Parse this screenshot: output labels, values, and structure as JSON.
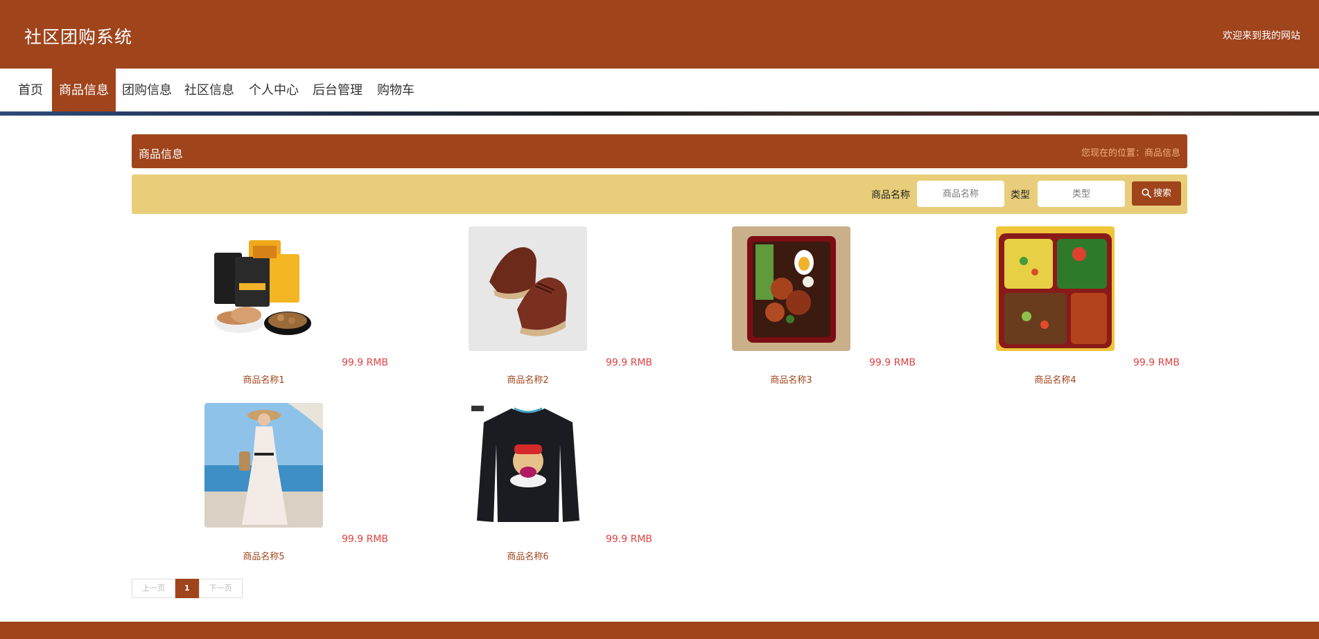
{
  "header": {
    "site_title": "社区团购系统",
    "welcome": "欢迎来到我的网站"
  },
  "nav": {
    "items": [
      {
        "label": "首页"
      },
      {
        "label": "商品信息"
      },
      {
        "label": "团购信息"
      },
      {
        "label": "社区信息"
      },
      {
        "label": "个人中心"
      },
      {
        "label": "后台管理"
      },
      {
        "label": "购物车"
      }
    ],
    "active": "商品信息"
  },
  "section": {
    "title": "商品信息",
    "breadcrumb": "您现在的位置：商品信息"
  },
  "search": {
    "name_label": "商品名称",
    "name_placeholder": "商品名称",
    "type_label": "类型",
    "type_placeholder": "类型",
    "button_label": "搜索",
    "button_icon": "search-icon"
  },
  "products": [
    {
      "name": "商品名称1",
      "price": "99.9 RMB",
      "image": "snack-food-image"
    },
    {
      "name": "商品名称2",
      "price": "99.9 RMB",
      "image": "leather-shoes-image"
    },
    {
      "name": "商品名称3",
      "price": "99.9 RMB",
      "image": "bento-box-image"
    },
    {
      "name": "商品名称4",
      "price": "99.9 RMB",
      "image": "lunch-box-image"
    },
    {
      "name": "商品名称5",
      "price": "99.9 RMB",
      "image": "dress-woman-image"
    },
    {
      "name": "商品名称6",
      "price": "99.9 RMB",
      "image": "black-tshirt-image"
    }
  ],
  "pagination": {
    "prev": "上一页",
    "current": "1",
    "next": "下一页"
  },
  "colors": {
    "brand": "#a0441c",
    "search_bar": "#e8ce7a",
    "price": "#e04040"
  }
}
